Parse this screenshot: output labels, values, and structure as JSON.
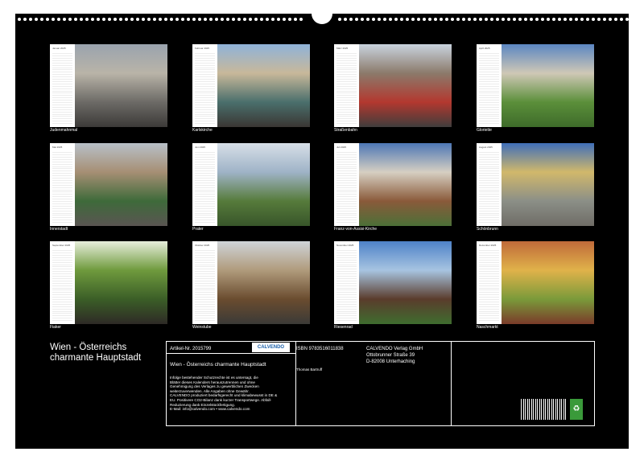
{
  "months": [
    {
      "month": "Januar 2025",
      "caption": "Judenmahnmal",
      "colors": [
        "#9aa3ae",
        "#b9b4a8",
        "#6c6a66",
        "#3c3a38"
      ]
    },
    {
      "month": "Februar 2025",
      "caption": "Karlskirche",
      "colors": [
        "#8fb3d9",
        "#c8b89a",
        "#4a6f6c",
        "#3a3633"
      ]
    },
    {
      "month": "März 2025",
      "caption": "Straßenbahn",
      "colors": [
        "#c9d3de",
        "#8b7a6b",
        "#b3382f",
        "#3f3d3c"
      ]
    },
    {
      "month": "April 2025",
      "caption": "Gloriette",
      "colors": [
        "#5b86c2",
        "#cfc8b6",
        "#5b8f3a",
        "#3e6b2a"
      ]
    },
    {
      "month": "Mai 2025",
      "caption": "Innerstadt",
      "colors": [
        "#b8c0c8",
        "#a68f74",
        "#3e6a3a",
        "#5a5552"
      ]
    },
    {
      "month": "Juni 2025",
      "caption": "Prater",
      "colors": [
        "#d7dfe7",
        "#9fb3c7",
        "#567b3b",
        "#38552a"
      ]
    },
    {
      "month": "Juli 2025",
      "caption": "Franz-von-Assisi-Kirche",
      "colors": [
        "#4d77b5",
        "#d6cfc2",
        "#8a5a3a",
        "#4c7038"
      ]
    },
    {
      "month": "August 2025",
      "caption": "Schönbrunn",
      "colors": [
        "#3f6fb9",
        "#d1b86b",
        "#8b8f87",
        "#6f6c66"
      ]
    },
    {
      "month": "September 2025",
      "caption": "Fiaker",
      "colors": [
        "#e7eedc",
        "#6f9a3d",
        "#3b5e27",
        "#2e2a26"
      ]
    },
    {
      "month": "Oktober 2025",
      "caption": "Weinstube",
      "colors": [
        "#cfd4d8",
        "#b09b7c",
        "#6a4c2f",
        "#3b3a37"
      ]
    },
    {
      "month": "November 2025",
      "caption": "Riesenrad",
      "colors": [
        "#4e82c8",
        "#a7c4e1",
        "#5a3c2c",
        "#3f6d2f"
      ]
    },
    {
      "month": "Dezember 2025",
      "caption": "Naschmarkt",
      "colors": [
        "#c06a3a",
        "#e0b24a",
        "#7a9a3a",
        "#7a3b2a"
      ]
    }
  ],
  "title_line1": "Wien - Österreichs",
  "title_line2": "charmante Hauptstadt",
  "info": {
    "article_label": "Artikel-Nr. 2015799",
    "logo": "CALVENDO",
    "isbn": "ISBN 9783516011838",
    "subtitle": "Wien - Österreichs charmante Hauptstadt",
    "author": "Thomas Bartruff",
    "publisher1": "CALVENDO Verlag GmbH",
    "publisher2": "Ottobrunner Straße 39",
    "publisher3": "D-82008 Unterhaching",
    "legal": [
      "Infolge bestehender Schutzrechte ist es untersagt, die",
      "Blätter dieses Kalenders herauszutrennen und ohne",
      "Genehmigung des Verlages zu gewerblichen Zwecken",
      "weiterzuverwenden. Alle Angaben ohne Gewähr.",
      "CALVENDO produziert bedarfsgerecht und klimabewusst in DE &",
      "EU. Positivere CO2-Bilanz dank kurzer Transportwege. Abfall-",
      "Reduzierung dank Einzelstückfertigung.",
      "E-Mail: info@calvendo.com • www.calvendo.com"
    ]
  }
}
